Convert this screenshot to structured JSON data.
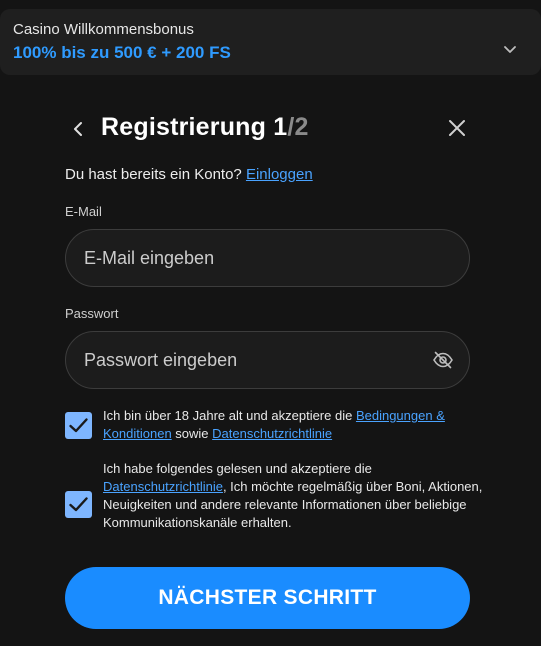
{
  "bonus": {
    "title": "Casino Willkommensbonus",
    "offer": "100% bis zu 500 € + 200 FS",
    "chevron_icon": "chevron-down-icon"
  },
  "header": {
    "title_main": "Registrierung 1",
    "title_sep": "/2",
    "back_icon": "chevron-left-icon",
    "close_icon": "close-icon"
  },
  "login_prompt": {
    "text": "Du hast bereits ein Konto?",
    "link": "Einloggen"
  },
  "email": {
    "label": "E-Mail",
    "placeholder": "E-Mail eingeben",
    "value": ""
  },
  "password": {
    "label": "Passwort",
    "placeholder": "Passwort eingeben",
    "value": "",
    "toggle_icon": "eye-off-icon"
  },
  "consent_age": {
    "checked": true,
    "text_before": "Ich bin über 18 Jahre alt und akzeptiere die ",
    "link_terms": "Bedingungen & Konditionen",
    "text_middle": " sowie ",
    "link_privacy": "Datenschutzrichtlinie"
  },
  "consent_marketing": {
    "checked": true,
    "text_before": "Ich habe folgendes gelesen und akzeptiere die ",
    "link_privacy": "Datenschutzrichtlinie",
    "text_after": ", Ich möchte regelmäßig über Boni, Aktionen, Neuigkeiten und andere relevante Informationen über beliebige Kommunikationskanäle erhalten."
  },
  "next_button": {
    "label": "NÄCHSTER SCHRITT"
  },
  "colors": {
    "accent": "#1a8cff",
    "link": "#4aa3ff",
    "checkbox": "#7eb6ff",
    "background": "#141414"
  }
}
